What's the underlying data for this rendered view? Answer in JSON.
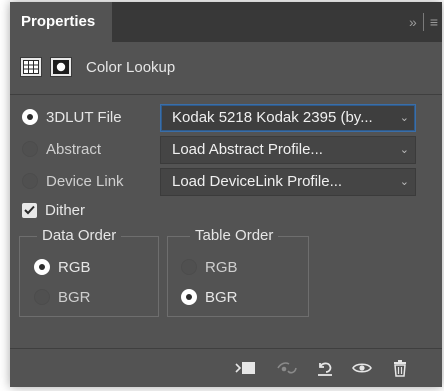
{
  "panel": {
    "tab_label": "Properties",
    "menu_chevrons": "»",
    "menu_lines": "≡"
  },
  "header": {
    "title": "Color Lookup",
    "icons": [
      "adjustment-layer-icon",
      "layer-mask-icon"
    ]
  },
  "lut_options": [
    {
      "label": "3DLUT File",
      "selected": true,
      "dropdown": "Kodak 5218 Kodak 2395 (by..."
    },
    {
      "label": "Abstract",
      "selected": false,
      "dropdown": "Load Abstract Profile..."
    },
    {
      "label": "Device Link",
      "selected": false,
      "dropdown": "Load DeviceLink Profile..."
    }
  ],
  "dither": {
    "label": "Dither",
    "checked": true
  },
  "data_order": {
    "legend": "Data Order",
    "options": [
      {
        "label": "RGB",
        "selected": true
      },
      {
        "label": "BGR",
        "selected": false
      }
    ]
  },
  "table_order": {
    "legend": "Table Order",
    "options": [
      {
        "label": "RGB",
        "selected": false
      },
      {
        "label": "BGR",
        "selected": true
      }
    ]
  },
  "bottom_icons": [
    "clip-to-layer-icon",
    "view-previous-state-icon",
    "reset-icon",
    "visibility-icon",
    "trash-icon"
  ],
  "colors": {
    "panel_bg": "#535353",
    "tabbar_bg": "#383838",
    "focus_border": "#3a6ea8"
  }
}
